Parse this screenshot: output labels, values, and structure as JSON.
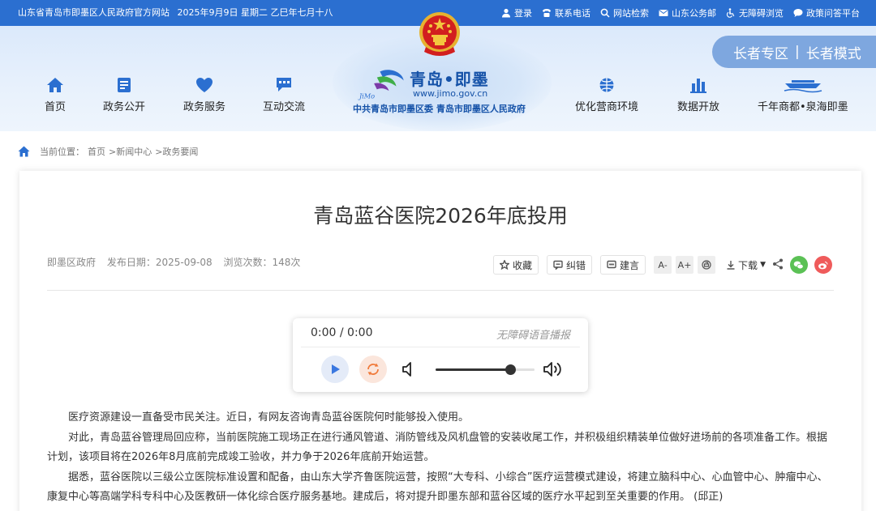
{
  "topbar": {
    "site_name": "山东省青岛市即墨区人民政府官方网站",
    "date": "2025年9月9日 星期二 乙巳年七月十八",
    "links": [
      "登录",
      "联系电话",
      "网站检索",
      "山东公务邮",
      "无障碍浏览",
      "政策问答平台"
    ]
  },
  "elder": {
    "zone": "长者专区",
    "sep": "|",
    "mode": "长者模式"
  },
  "nav": {
    "left": [
      "首页",
      "政务公开",
      "政务服务",
      "互动交流"
    ],
    "right": [
      "优化营商环境",
      "数据开放",
      "千年商都•泉海即墨"
    ]
  },
  "logo": {
    "title": "青岛•即墨",
    "url": "www.jimo.gov.cn",
    "subtitle": "中共青岛市即墨区委 青岛市即墨区人民政府"
  },
  "breadcrumb": {
    "label": "当前位置：",
    "items": [
      "首页",
      ">新闻中心",
      ">政务要闻"
    ]
  },
  "article": {
    "title": "青岛蓝谷医院2026年底投用",
    "source": "即墨区政府",
    "publish_label": "发布日期：",
    "publish_date": "2025-09-08",
    "views_label": "浏览次数：",
    "views": "148次",
    "paragraphs": [
      "医疗资源建设一直备受市民关注。近日，有网友咨询青岛蓝谷医院何时能够投入使用。",
      "对此，青岛蓝谷管理局回应称，当前医院施工现场正在进行通风管道、消防管线及风机盘管的安装收尾工作，并积极组织精装单位做好进场前的各项准备工作。根据计划，该项目将在2026年8月底前完成竣工验收，并力争于2026年底前开始运营。",
      "据悉，蓝谷医院以三级公立医院标准设置和配备，由山东大学齐鲁医院运营，按照“大专科、小综合”医疗运营模式建设，将建立脑科中心、心血管中心、肿瘤中心、康复中心等高端学科专科中心及医教研一体化综合医疗服务基地。建成后，将对提升即墨东部和蓝谷区域的医疗水平起到至关重要的作用。 (邱正)"
    ]
  },
  "tools": {
    "collect": "收藏",
    "correct": "纠错",
    "comment": "建言",
    "font_small": "A-",
    "font_large": "A+",
    "download": "下载"
  },
  "player": {
    "time": "0:00 / 0:00",
    "label": "无障碍语音播报",
    "volume": 0.75
  },
  "colors": {
    "topbar": "#2b6fd0",
    "accent": "#2b6fd0",
    "elder_tab": "#7ea7df",
    "wechat": "#5bc155",
    "weibo": "#ef5b5b"
  }
}
